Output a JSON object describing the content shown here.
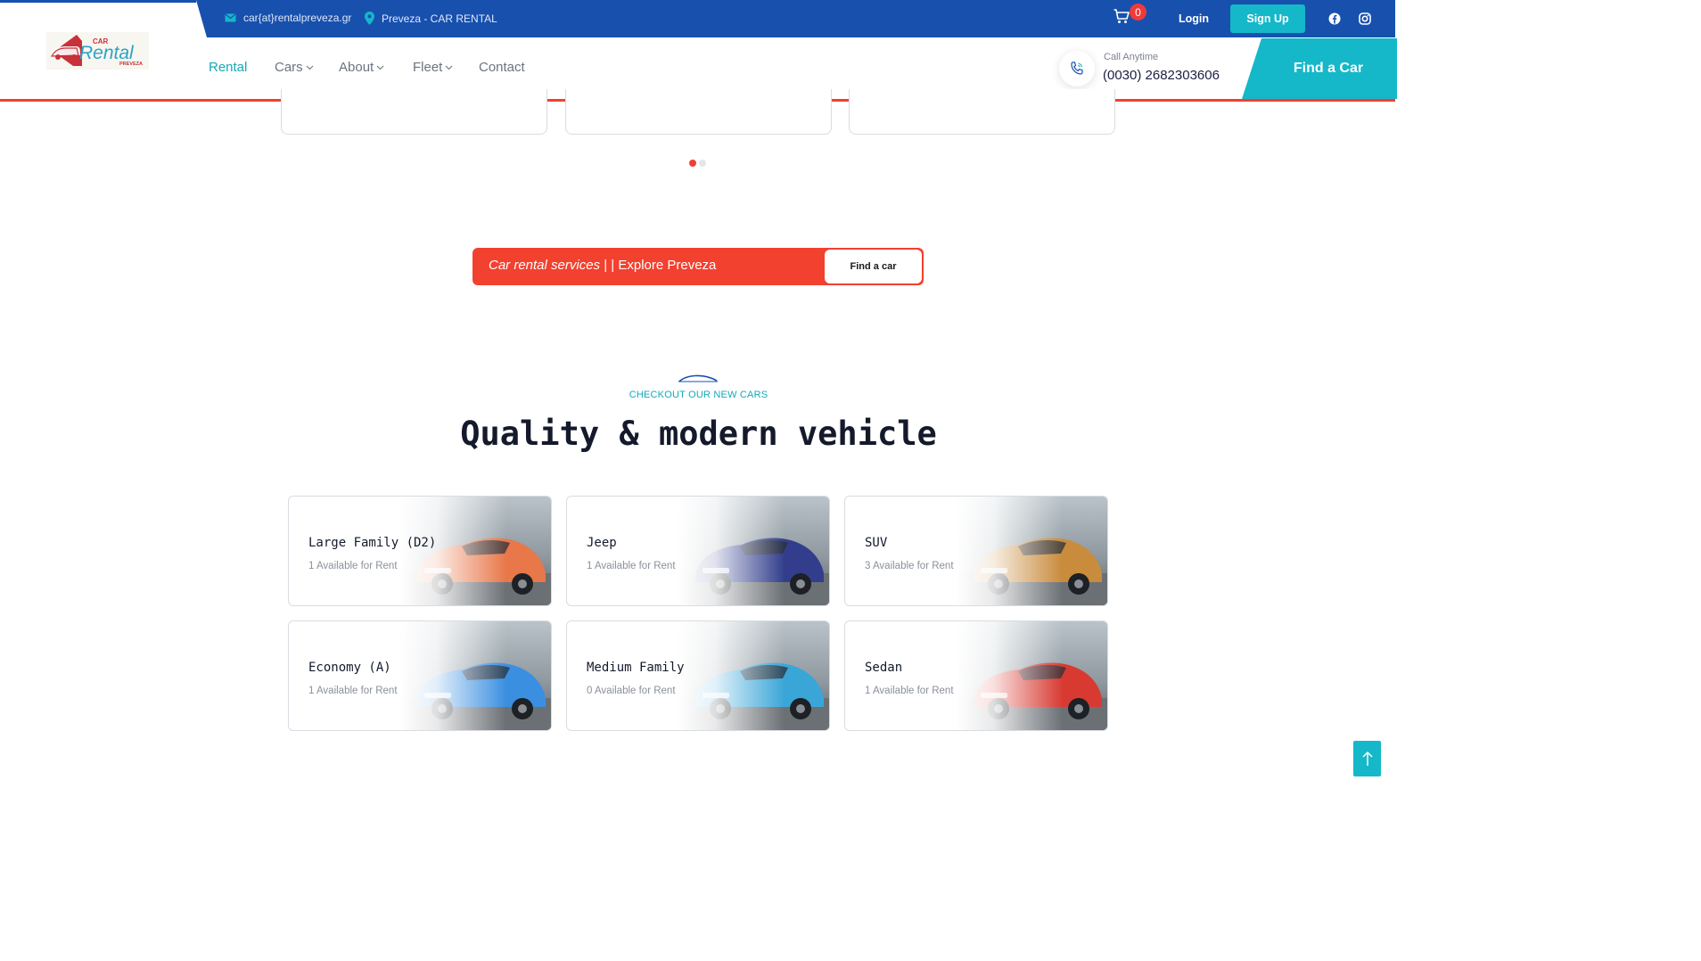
{
  "topbar": {
    "email": "car{at}rentalpreveza.gr",
    "location": "Preveza - CAR RENTAL",
    "cart_count": "0",
    "login_label": "Login",
    "signup_label": "Sign Up",
    "social": [
      "facebook-icon",
      "instagram-icon"
    ]
  },
  "header": {
    "logo_alt": "Car Rental Preveza",
    "nav": [
      {
        "label": "Rental",
        "active": true,
        "dropdown": false
      },
      {
        "label": "Cars",
        "active": false,
        "dropdown": true
      },
      {
        "label": "About",
        "active": false,
        "dropdown": true
      },
      {
        "label": "Fleet",
        "active": false,
        "dropdown": true
      },
      {
        "label": "Contact",
        "active": false,
        "dropdown": false
      }
    ],
    "call_label": "Call Anytime",
    "call_number": "(0030) 2682303606",
    "find_car_label": "Find a Car"
  },
  "carousel": {
    "active_dot": 0,
    "dot_count": 2
  },
  "promo": {
    "italic_text": "Car rental services",
    "text": " | | Explore Preveza",
    "button_label": "Find a car"
  },
  "section": {
    "kicker": "CHECKOUT OUR NEW CARS",
    "title": "Quality & modern vehicle"
  },
  "categories": [
    {
      "name": "Large Family (D2)",
      "availability": "1 Available for Rent",
      "car_color": "#e8774a"
    },
    {
      "name": "Jeep",
      "availability": "1 Available for Rent",
      "car_color": "#323e8c"
    },
    {
      "name": "SUV",
      "availability": "3 Available for Rent",
      "car_color": "#c98b3c"
    },
    {
      "name": "Economy (A)",
      "availability": "1 Available for Rent",
      "car_color": "#3b8fe0"
    },
    {
      "name": "Medium Family",
      "availability": "0 Available for Rent",
      "car_color": "#3aa6d8"
    },
    {
      "name": "Sedan",
      "availability": "1 Available for Rent",
      "car_color": "#d83a32"
    }
  ],
  "colors": {
    "topbar_blue": "#1850ae",
    "accent_teal": "#14b8c9",
    "accent_red": "#f2412f"
  }
}
